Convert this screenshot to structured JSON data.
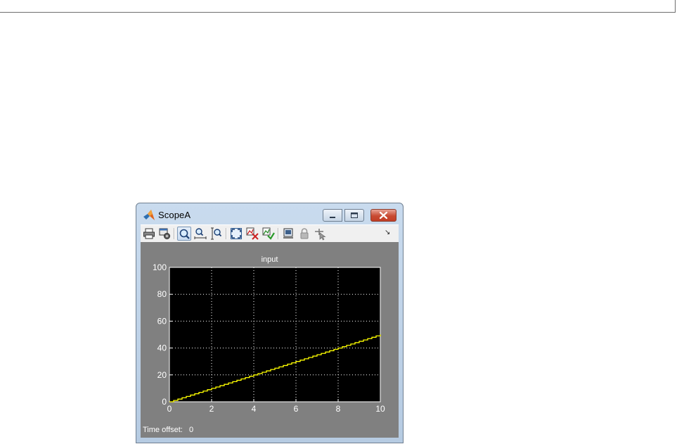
{
  "window": {
    "title": "ScopeA"
  },
  "toolbar": {
    "buttons": [
      {
        "name": "print-icon"
      },
      {
        "name": "parameters-icon"
      },
      {
        "name": "zoom-icon",
        "pressed": true
      },
      {
        "name": "zoom-x-icon"
      },
      {
        "name": "zoom-y-icon"
      },
      {
        "name": "autoscale-icon"
      },
      {
        "name": "save-axes-settings-icon"
      },
      {
        "name": "restore-axes-settings-icon"
      },
      {
        "name": "floating-scope-icon"
      },
      {
        "name": "lock-axes-icon"
      },
      {
        "name": "signal-selection-icon"
      }
    ],
    "menu_arrow": "↘"
  },
  "footer": {
    "label": "Time offset:",
    "value": "0"
  },
  "colors": {
    "plot_background": "#000000",
    "figure_background": "#808080",
    "signal": "#ffff00",
    "grid": "#ffffff"
  },
  "chart_data": {
    "type": "line",
    "title": "input",
    "xlabel": "",
    "ylabel": "",
    "xlim": [
      0,
      10
    ],
    "ylim": [
      0,
      100
    ],
    "xticks": [
      0,
      2,
      4,
      6,
      8,
      10
    ],
    "yticks": [
      0,
      20,
      40,
      60,
      80,
      100
    ],
    "grid": true,
    "step": true,
    "series": [
      {
        "x": [
          0,
          0.2,
          0.4,
          0.6,
          0.8,
          1.0,
          1.2,
          1.4,
          1.6,
          1.8,
          2.0,
          2.2,
          2.4,
          2.6,
          2.8,
          3.0,
          3.2,
          3.4,
          3.6,
          3.8,
          4.0,
          4.2,
          4.4,
          4.6,
          4.8,
          5.0,
          5.2,
          5.4,
          5.6,
          5.8,
          6.0,
          6.2,
          6.4,
          6.6,
          6.8,
          7.0,
          7.2,
          7.4,
          7.6,
          7.8,
          8.0,
          8.2,
          8.4,
          8.6,
          8.8,
          9.0,
          9.2,
          9.4,
          9.6,
          9.8,
          10.0
        ],
        "y": [
          0,
          1,
          2,
          3,
          4,
          5,
          6,
          7,
          8,
          9,
          10,
          11,
          12,
          13,
          14,
          15,
          16,
          17,
          18,
          19,
          20,
          21,
          22,
          23,
          24,
          25,
          26,
          27,
          28,
          29,
          30,
          31,
          32,
          33,
          34,
          35,
          36,
          37,
          38,
          39,
          40,
          41,
          42,
          43,
          44,
          45,
          46,
          47,
          48,
          49,
          50
        ]
      }
    ]
  }
}
